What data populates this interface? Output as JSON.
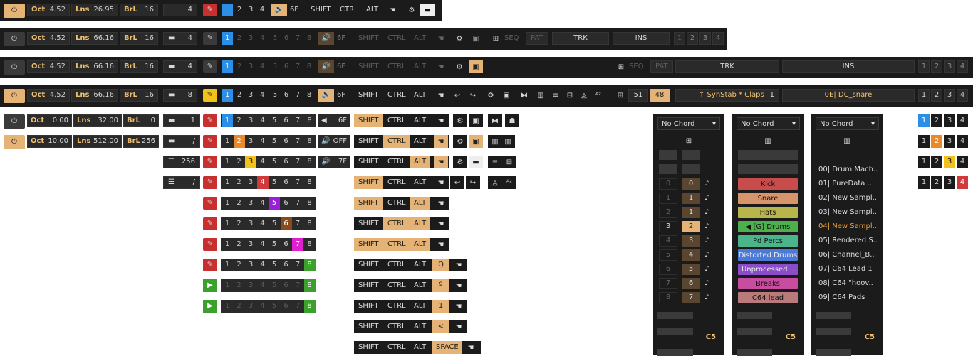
{
  "toolbars": [
    {
      "oct": "4.52",
      "lns": "26.95",
      "brl": "16",
      "field": "4",
      "mods": [
        "SHIFT",
        "CTRL",
        "ALT"
      ],
      "fx": "6F"
    },
    {
      "oct": "4.52",
      "lns": "66.16",
      "brl": "16",
      "field": "4",
      "mods": [
        "SHIFT",
        "CTRL",
        "ALT"
      ],
      "fx": "6F",
      "seq": "SEQ",
      "pat": "PAT",
      "trk": "TRK",
      "ins": "INS"
    },
    {
      "oct": "4.52",
      "lns": "66.16",
      "brl": "16",
      "field": "4",
      "mods": [
        "SHIFT",
        "CTRL",
        "ALT"
      ],
      "fx": "6F",
      "seq": "SEQ",
      "pat": "PAT",
      "trk": "TRK",
      "ins": "INS"
    },
    {
      "oct": "4.52",
      "lns": "66.16",
      "brl": "16",
      "field": "8",
      "mods": [
        "SHIFT",
        "CTRL",
        "ALT"
      ],
      "fx": "6F",
      "steps": "51",
      "steps2": "48",
      "trk": "↑ SynStab * Claps",
      "trk_num": "1",
      "ins": "0E| DC_snare"
    }
  ],
  "labels": {
    "oct": "Oct",
    "lns": "Lns",
    "brl": "BrL"
  },
  "digits": [
    "1",
    "2",
    "3",
    "4",
    "5",
    "6",
    "7",
    "8"
  ],
  "quad": [
    "1",
    "2",
    "3",
    "4"
  ],
  "mini": [
    {
      "oct": "0.00",
      "lns": "32.00",
      "brl": "0"
    },
    {
      "oct": "10.00",
      "lns": "512.00",
      "brl": "256"
    }
  ],
  "fields": [
    "1",
    "/",
    "256",
    "/"
  ],
  "fx_rows": [
    "6F",
    "OFF",
    "7F"
  ],
  "key_labels": [
    "Q",
    "º",
    "1",
    "<",
    "SPACE"
  ],
  "panels": {
    "chord": "No Chord",
    "pitch_label": "C5",
    "steps": [
      {
        "idx": "0",
        "val": "0"
      },
      {
        "idx": "1",
        "val": "1"
      },
      {
        "idx": "2",
        "val": "1"
      },
      {
        "idx": "3",
        "val": "2"
      },
      {
        "idx": "4",
        "val": "3"
      },
      {
        "idx": "5",
        "val": "4"
      },
      {
        "idx": "6",
        "val": "5"
      },
      {
        "idx": "7",
        "val": "6"
      },
      {
        "idx": "8",
        "val": "7"
      }
    ],
    "note": "♪",
    "instruments": [
      {
        "name": "Kick",
        "color": "#c84c4c"
      },
      {
        "name": "Snare",
        "color": "#d8946a"
      },
      {
        "name": "Hats",
        "color": "#b8b64a"
      },
      {
        "name": "◀ [G] Drums",
        "color": "#4cb04c"
      },
      {
        "name": "Pd Percs",
        "color": "#4cb48a"
      },
      {
        "name": "Distorted Drums",
        "color": "#4c7ad8"
      },
      {
        "name": "Unprocessed ..",
        "color": "#8a4cc8"
      },
      {
        "name": "Breaks",
        "color": "#c84ca0"
      },
      {
        "name": "C64 lead",
        "color": "#b87a7a"
      }
    ],
    "samples": [
      "00| Drum Mach..",
      "01| PureData ..",
      "02| New Sampl..",
      "03| New Sampl..",
      "04| New Sampl..",
      "05| Rendered S..",
      "06| Channel_B..",
      "07| C64 Lead 1",
      "08| C64 \"hoov..",
      "09| C64 Pads"
    ]
  },
  "colors": {
    "accent": "#e5b376",
    "label": "#f0c070",
    "bg": "#1b1b1b"
  }
}
